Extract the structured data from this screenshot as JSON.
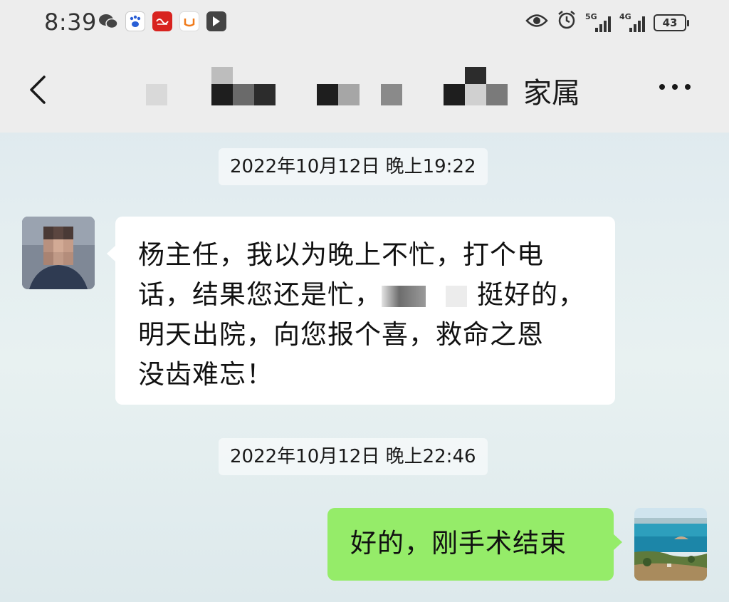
{
  "status_bar": {
    "time": "8:39",
    "notification_icons": [
      "wechat-icon",
      "baidu-icon",
      "xuexi-icon",
      "didi-icon",
      "lark-icon"
    ],
    "network_1": "5G",
    "network_2": "4G",
    "battery": "43"
  },
  "nav": {
    "title_suffix": "家属"
  },
  "messages": [
    {
      "timestamp": "2022年10月12日 晚上19:22",
      "sender": "contact",
      "lines": [
        "杨主任，我以为晚上不忙，打个电",
        "话，结果您还是忙，",
        "挺好的，",
        "明天出院，向您报个喜，救命之恩",
        "没齿难忘！"
      ]
    },
    {
      "timestamp": "2022年10月12日 晚上22:46",
      "sender": "me",
      "text": "好的，刚手术结束"
    }
  ],
  "colors": {
    "sent_bubble": "#95ec69",
    "received_bubble": "#ffffff",
    "header_bg": "#ededed"
  }
}
